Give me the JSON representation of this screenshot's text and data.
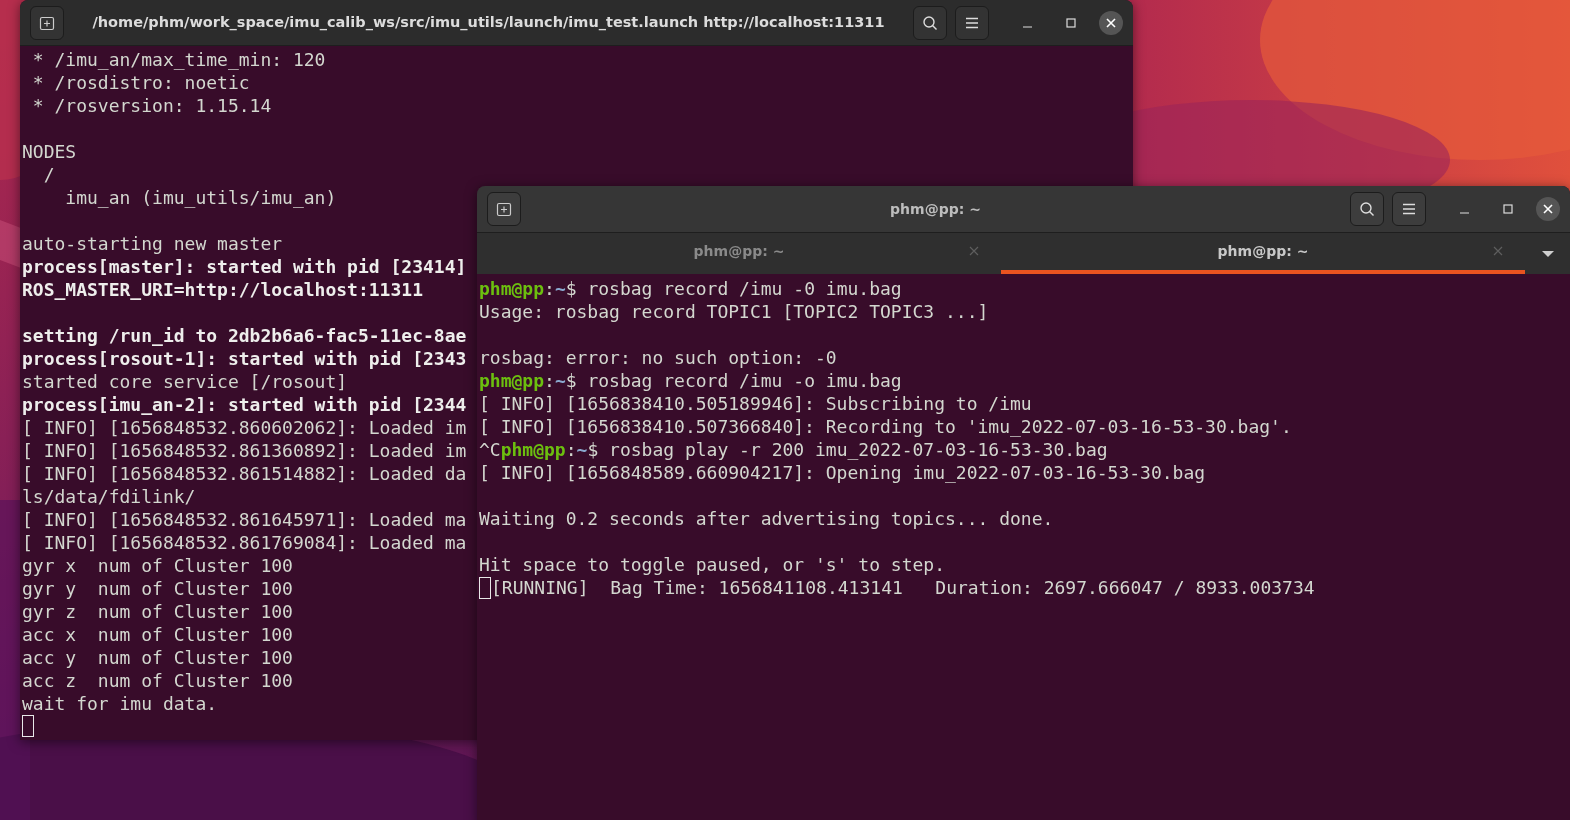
{
  "back_terminal": {
    "title": "/home/phm/work_space/imu_calib_ws/src/imu_utils/launch/imu_test.launch http://localhost:11311",
    "blocks": [
      {
        "lines": [
          {
            "text": " * /imu_an/max_time_min: 120",
            "bold": false
          },
          {
            "text": " * /rosdistro: noetic",
            "bold": false
          },
          {
            "text": " * /rosversion: 1.15.14",
            "bold": false
          }
        ]
      },
      {
        "lines": [
          {
            "text": "NODES",
            "bold": false
          },
          {
            "text": "  /",
            "bold": false
          },
          {
            "text": "    imu_an (imu_utils/imu_an)",
            "bold": false
          }
        ]
      },
      {
        "lines": [
          {
            "text": "auto-starting new master",
            "bold": false
          },
          {
            "text": "process[master]: started with pid [23414]",
            "bold": true
          },
          {
            "text": "ROS_MASTER_URI=http://localhost:11311",
            "bold": true
          }
        ]
      },
      {
        "lines": [
          {
            "text": "setting /run_id to 2db2b6a6-fac5-11ec-8ae",
            "bold": true
          },
          {
            "text": "process[rosout-1]: started with pid [2343",
            "bold": true
          },
          {
            "text": "started core service [/rosout]",
            "bold": false
          },
          {
            "text": "process[imu_an-2]: started with pid [2344",
            "bold": true
          },
          {
            "text": "[ INFO] [1656848532.860602062]: Loaded im",
            "bold": false
          },
          {
            "text": "[ INFO] [1656848532.861360892]: Loaded im",
            "bold": false
          },
          {
            "text": "[ INFO] [1656848532.861514882]: Loaded da",
            "bold": false
          },
          {
            "text": "ls/data/fdilink/",
            "bold": false
          },
          {
            "text": "[ INFO] [1656848532.861645971]: Loaded ma",
            "bold": false
          },
          {
            "text": "[ INFO] [1656848532.861769084]: Loaded ma",
            "bold": false
          },
          {
            "text": "gyr x  num of Cluster 100",
            "bold": false
          },
          {
            "text": "gyr y  num of Cluster 100",
            "bold": false
          },
          {
            "text": "gyr z  num of Cluster 100",
            "bold": false
          },
          {
            "text": "acc x  num of Cluster 100",
            "bold": false
          },
          {
            "text": "acc y  num of Cluster 100",
            "bold": false
          },
          {
            "text": "acc z  num of Cluster 100",
            "bold": false
          },
          {
            "text": "wait for imu data.",
            "bold": false
          },
          {
            "cursor": true
          }
        ]
      }
    ]
  },
  "front_terminal": {
    "title": "phm@pp: ~",
    "tabs": [
      {
        "label": "phm@pp: ~",
        "selected": false
      },
      {
        "label": "phm@pp: ~",
        "selected": true
      }
    ],
    "blocks": [
      {
        "lines": [
          {
            "segments": [
              {
                "kind": "user",
                "text": "phm@pp"
              },
              {
                "kind": "plain",
                "text": ":"
              },
              {
                "kind": "path",
                "text": "~"
              },
              {
                "kind": "plain",
                "text": "$ rosbag record /imu -0 imu.bag"
              }
            ]
          },
          {
            "segments": [
              {
                "kind": "plain",
                "text": "Usage: rosbag record TOPIC1 [TOPIC2 TOPIC3 ...]"
              }
            ]
          }
        ]
      },
      {
        "lines": [
          {
            "segments": [
              {
                "kind": "plain",
                "text": "rosbag: error: no such option: -0"
              }
            ]
          },
          {
            "segments": [
              {
                "kind": "user",
                "text": "phm@pp"
              },
              {
                "kind": "plain",
                "text": ":"
              },
              {
                "kind": "path",
                "text": "~"
              },
              {
                "kind": "plain",
                "text": "$ rosbag record /imu -o imu.bag"
              }
            ]
          },
          {
            "segments": [
              {
                "kind": "plain",
                "text": "[ INFO] [1656838410.505189946]: Subscribing to /imu"
              }
            ]
          },
          {
            "segments": [
              {
                "kind": "plain",
                "text": "[ INFO] [1656838410.507366840]: Recording to 'imu_2022-07-03-16-53-30.bag'."
              }
            ]
          },
          {
            "segments": [
              {
                "kind": "plain",
                "text": "^C"
              },
              {
                "kind": "user",
                "text": "phm@pp"
              },
              {
                "kind": "plain",
                "text": ":"
              },
              {
                "kind": "path",
                "text": "~"
              },
              {
                "kind": "plain",
                "text": "$ rosbag play -r 200 imu_2022-07-03-16-53-30.bag"
              }
            ]
          },
          {
            "segments": [
              {
                "kind": "plain",
                "text": "[ INFO] [1656848589.660904217]: Opening imu_2022-07-03-16-53-30.bag"
              }
            ]
          }
        ]
      },
      {
        "lines": [
          {
            "segments": [
              {
                "kind": "plain",
                "text": "Waiting 0.2 seconds after advertising topics... done."
              }
            ]
          }
        ]
      },
      {
        "lines": [
          {
            "segments": [
              {
                "kind": "plain",
                "text": "Hit space to toggle paused, or 's' to step."
              }
            ]
          },
          {
            "cursor": true,
            "segments": [
              {
                "kind": "plain",
                "text": "[RUNNING]  Bag Time: 1656841108.413141   Duration: 2697.666047 / 8933.003734"
              }
            ]
          }
        ]
      }
    ]
  }
}
